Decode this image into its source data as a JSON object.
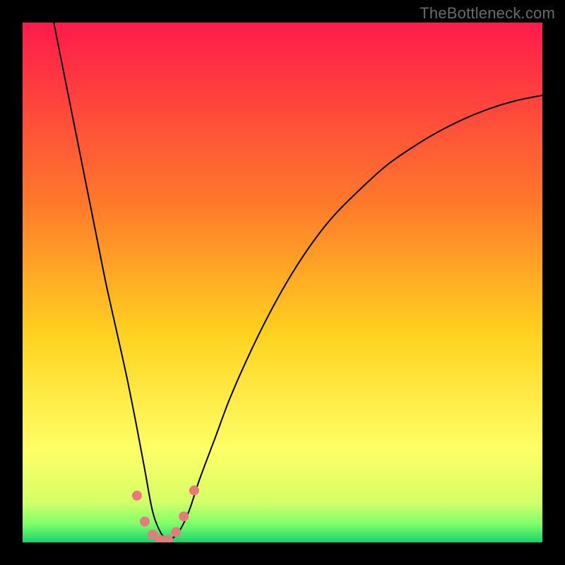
{
  "watermark": {
    "text": "TheBottleneck.com"
  },
  "chart_data": {
    "type": "line",
    "title": "",
    "xlabel": "",
    "ylabel": "",
    "xlim": [
      0,
      100
    ],
    "ylim": [
      0,
      100
    ],
    "grid": false,
    "legend": false,
    "background_gradient": {
      "stops": [
        {
          "pos": 0.0,
          "color": "#ff1a4b"
        },
        {
          "pos": 0.35,
          "color": "#ff7a2a"
        },
        {
          "pos": 0.6,
          "color": "#ffd21f"
        },
        {
          "pos": 0.82,
          "color": "#ffff66"
        },
        {
          "pos": 0.92,
          "color": "#d6ff66"
        },
        {
          "pos": 0.965,
          "color": "#7dff6a"
        },
        {
          "pos": 1.0,
          "color": "#17d36b"
        }
      ]
    },
    "series": [
      {
        "name": "bottleneck-curve",
        "color": "#000000",
        "x": [
          6,
          8,
          10,
          12,
          14,
          16,
          18,
          20,
          22,
          23.5,
          25,
          26.5,
          28,
          30,
          32,
          34,
          37,
          40,
          44,
          48,
          52,
          56,
          60,
          65,
          70,
          75,
          80,
          85,
          90,
          95,
          100
        ],
        "y": [
          100,
          90,
          80,
          70,
          60,
          50,
          41,
          32,
          22,
          14,
          6,
          2,
          0.5,
          2,
          6,
          12,
          20,
          28,
          37,
          45,
          52,
          58,
          63,
          68,
          72.5,
          76,
          79,
          81.5,
          83.5,
          85,
          86
        ]
      }
    ],
    "markers": {
      "name": "minimum-dots",
      "color": "#e77a7a",
      "radius_px": 7,
      "points": [
        {
          "x": 22.0,
          "y": 9.0
        },
        {
          "x": 23.5,
          "y": 4.0
        },
        {
          "x": 25.0,
          "y": 1.5
        },
        {
          "x": 26.5,
          "y": 0.5
        },
        {
          "x": 28.0,
          "y": 0.5
        },
        {
          "x": 29.5,
          "y": 2.0
        },
        {
          "x": 31.0,
          "y": 5.0
        },
        {
          "x": 33.0,
          "y": 10.0
        }
      ]
    }
  }
}
